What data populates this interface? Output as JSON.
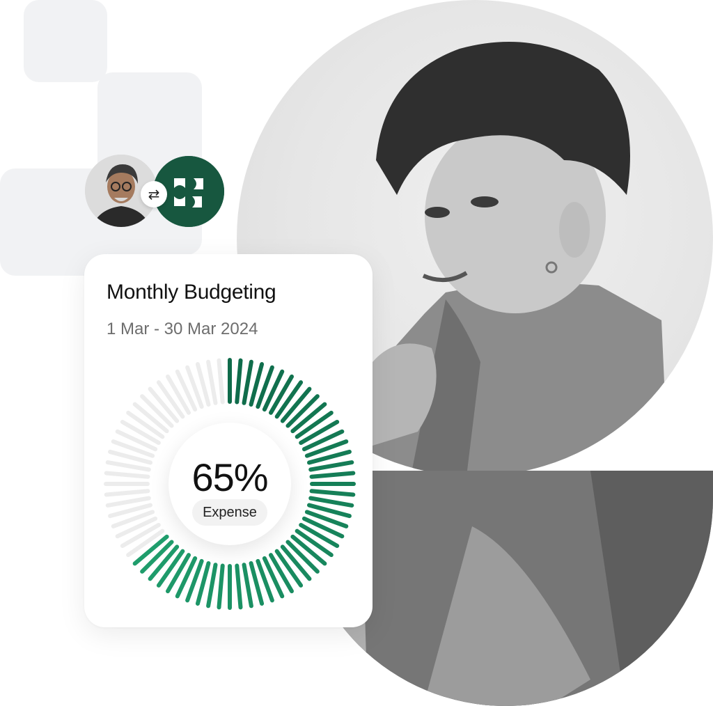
{
  "budget_card": {
    "title": "Monthly Budgeting",
    "date_range": "1 Mar - 30 Mar 2024",
    "percent_value": 65,
    "percent_label": "65%",
    "category": "Expense"
  },
  "swap_icon": "⇄",
  "colors": {
    "accent_green": "#17573f",
    "ring_dark": "#0f6b4a",
    "ring_light": "#1f9d6c",
    "ring_empty": "#ececec",
    "brand_bg": "#17573f"
  },
  "icons": {
    "swap": "swap-arrows-icon",
    "brand": "brand-logo-icon"
  }
}
